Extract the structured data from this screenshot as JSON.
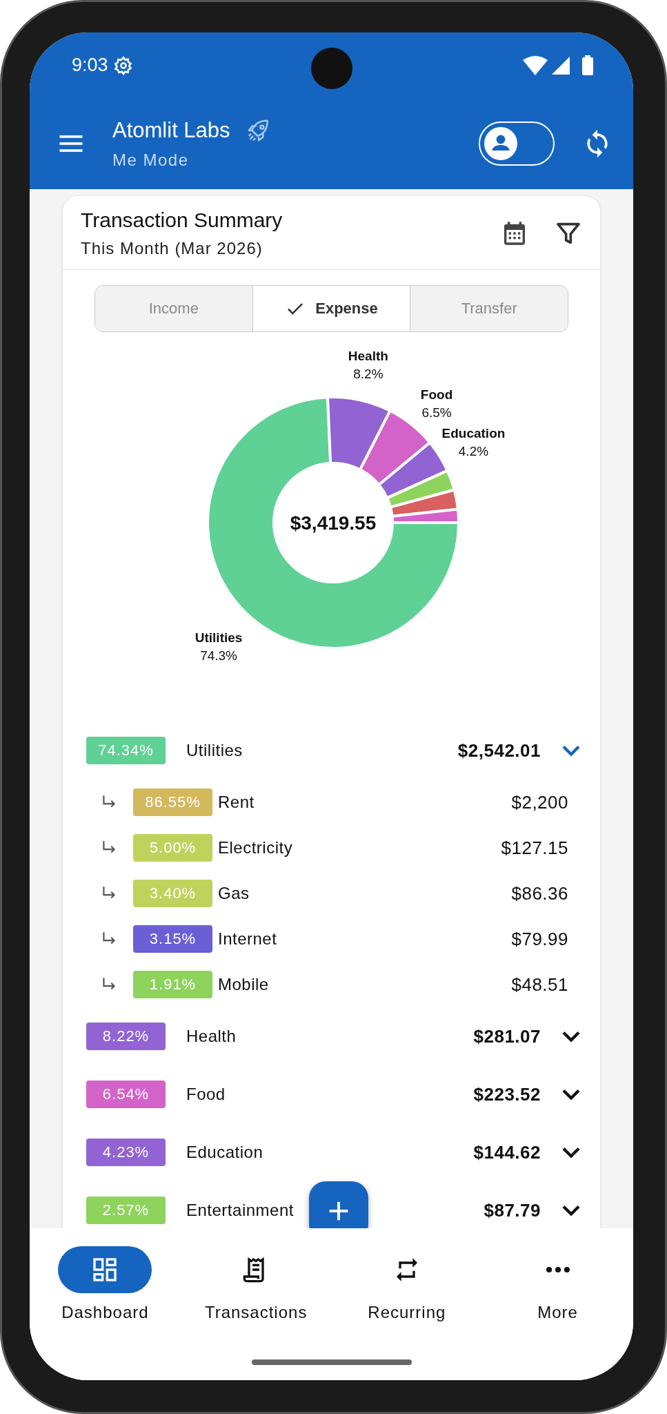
{
  "status_bar": {
    "time": "9:03"
  },
  "app_bar": {
    "title": "Atomlit Labs",
    "subtitle": "Me Mode",
    "mode_toggle": {
      "on": false
    }
  },
  "summary_card": {
    "title": "Transaction Summary",
    "subtitle": "This Month (Mar 2026)",
    "segments": [
      {
        "label": "Income",
        "selected": false
      },
      {
        "label": "Expense",
        "selected": true
      },
      {
        "label": "Transfer",
        "selected": false
      }
    ],
    "total": "$3,419.55",
    "chart_data": {
      "type": "donut",
      "categories": [
        "Utilities",
        "Health",
        "Food",
        "Education",
        null,
        null,
        null
      ],
      "values": [
        74.3,
        8.2,
        6.5,
        4.2,
        2.6,
        2.5,
        1.7
      ],
      "colors": [
        "#5fd195",
        "#9163d3",
        "#d363c8",
        "#9163d3",
        "#8ed35c",
        "#d96060",
        "#d363c8"
      ],
      "value_labels": [
        "74.3%",
        "8.2%",
        "6.5%",
        "4.2%",
        null,
        null,
        null
      ]
    },
    "categories": [
      {
        "percent": "74.34%",
        "name": "Utilities",
        "amount": "$2,542.01",
        "color": "#5fd195",
        "expanded": true,
        "children": [
          {
            "percent": "86.55%",
            "name": "Rent",
            "amount": "$2,200",
            "color": "#d4b85c"
          },
          {
            "percent": "5.00%",
            "name": "Electricity",
            "amount": "$127.15",
            "color": "#bfd35c"
          },
          {
            "percent": "3.40%",
            "name": "Gas",
            "amount": "$86.36",
            "color": "#bfd35c"
          },
          {
            "percent": "3.15%",
            "name": "Internet",
            "amount": "$79.99",
            "color": "#6b5fd6"
          },
          {
            "percent": "1.91%",
            "name": "Mobile",
            "amount": "$48.51",
            "color": "#8ed35c"
          }
        ]
      },
      {
        "percent": "8.22%",
        "name": "Health",
        "amount": "$281.07",
        "color": "#9163d3",
        "expanded": false
      },
      {
        "percent": "6.54%",
        "name": "Food",
        "amount": "$223.52",
        "color": "#d363c8",
        "expanded": false
      },
      {
        "percent": "4.23%",
        "name": "Education",
        "amount": "$144.62",
        "color": "#9163d3",
        "expanded": false
      },
      {
        "percent": "2.57%",
        "name": "Entertainment",
        "amount": "$87.79",
        "color": "#8ed35c",
        "expanded": false
      }
    ]
  },
  "bottom_nav": [
    {
      "label": "Dashboard",
      "kind": "dashboard",
      "selected": true
    },
    {
      "label": "Transactions",
      "kind": "receipt",
      "selected": false
    },
    {
      "label": "Recurring",
      "kind": "repeat",
      "selected": false
    },
    {
      "label": "More",
      "kind": "more",
      "selected": false
    }
  ]
}
